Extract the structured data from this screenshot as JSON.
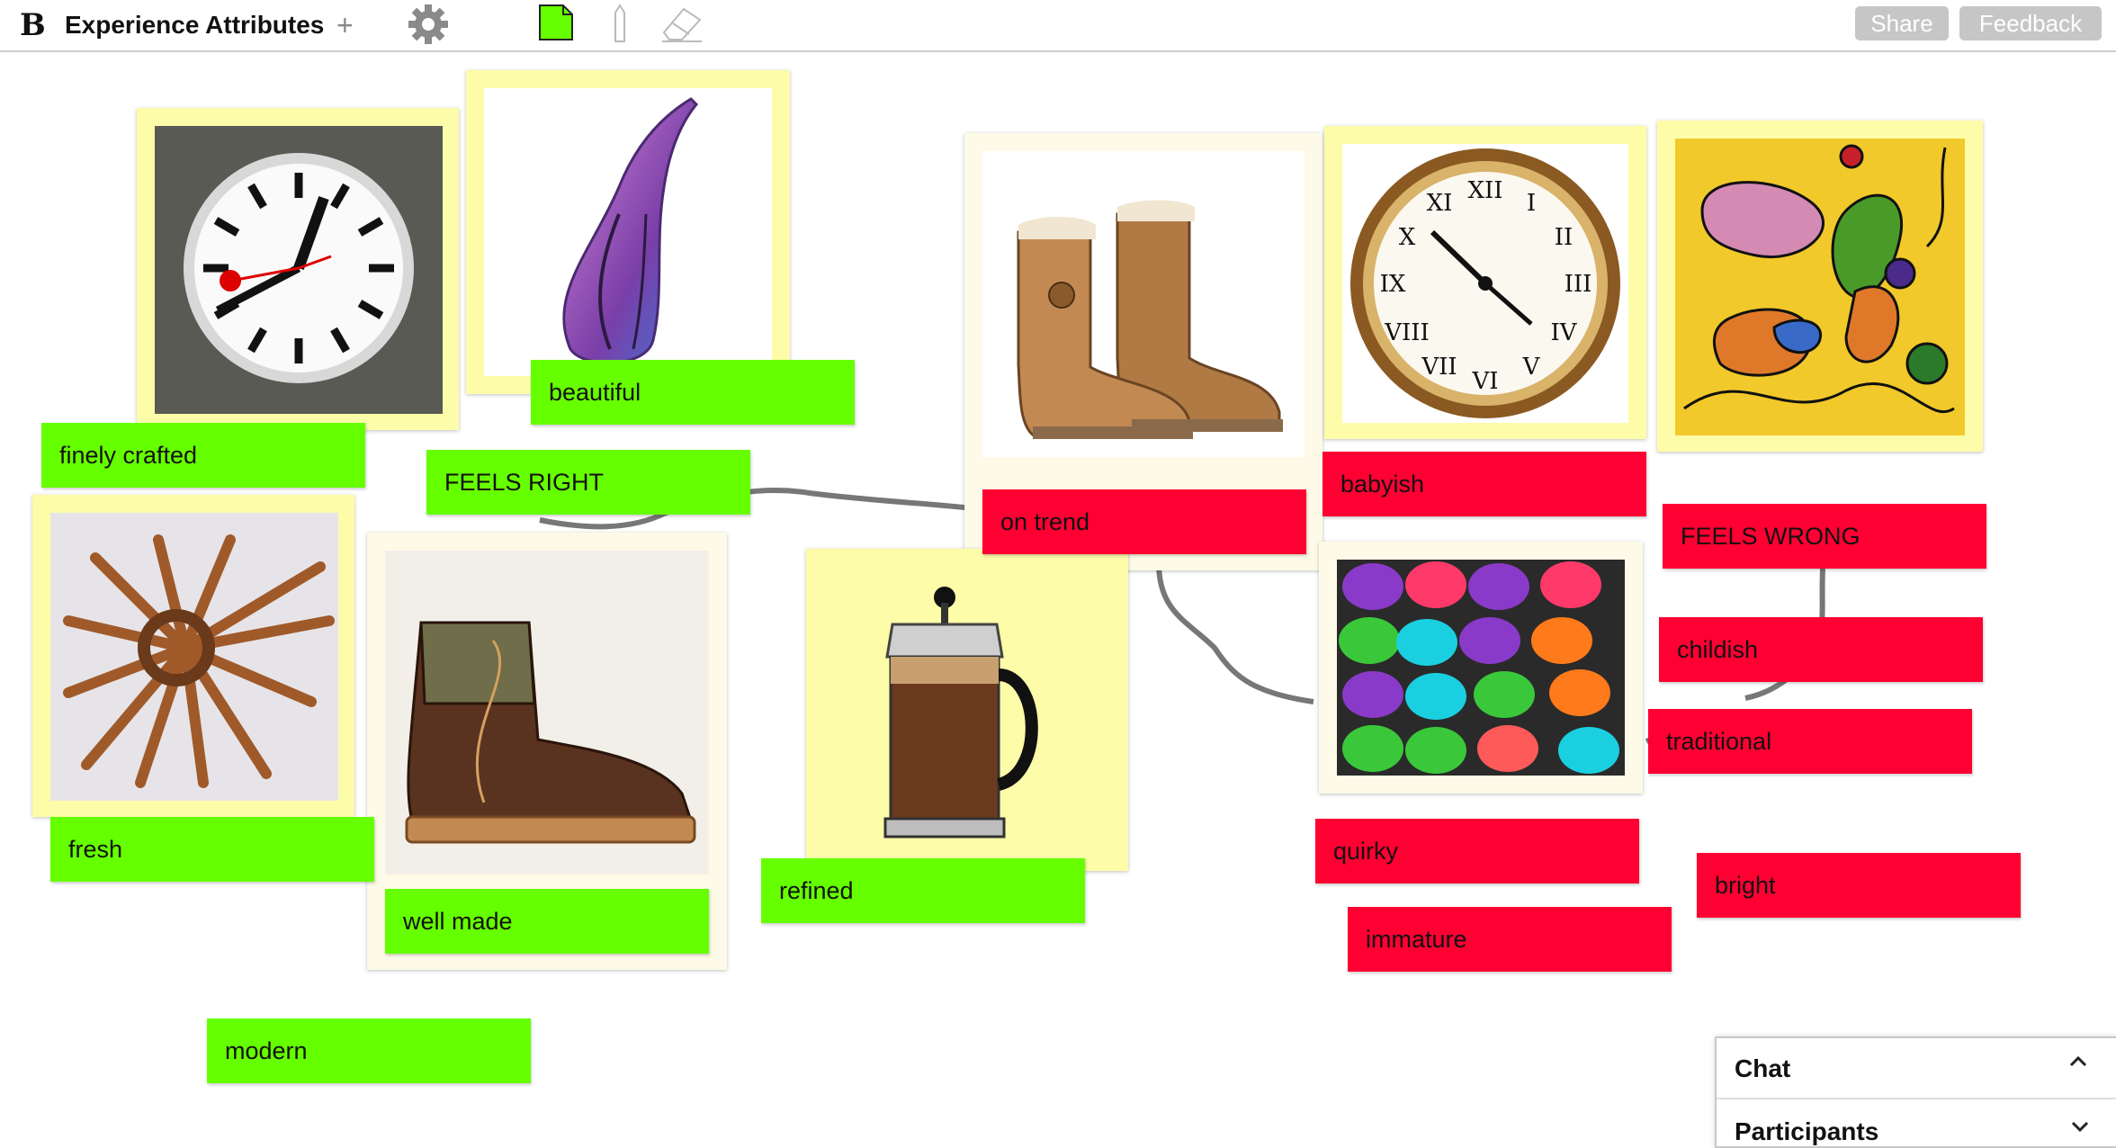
{
  "app": {
    "logo": "B",
    "board_title": "Experience Attributes",
    "add_label": "+",
    "share_label": "Share",
    "feedback_label": "Feedback"
  },
  "tools": {
    "settings_icon": "gear-icon",
    "note_tool_icon": "sticky-note-icon",
    "pen_tool_icon": "pencil-icon",
    "eraser_tool_icon": "eraser-icon"
  },
  "colors": {
    "positive_sticky": "#66ff00",
    "negative_sticky": "#ff0033",
    "image_card": "#fdfca9"
  },
  "images": [
    {
      "id": "clock-station",
      "subject": "station wall clock"
    },
    {
      "id": "vase",
      "subject": "purple glass vase"
    },
    {
      "id": "boots-ugg",
      "subject": "sheepskin boots"
    },
    {
      "id": "clock-antique",
      "subject": "antique roman numeral clock"
    },
    {
      "id": "abstract-art",
      "subject": "abstract colorful drawing"
    },
    {
      "id": "sculpture",
      "subject": "wooden spiral sculpture"
    },
    {
      "id": "boot-leather",
      "subject": "leather work boot"
    },
    {
      "id": "french-press",
      "subject": "french press coffee maker"
    },
    {
      "id": "crocs",
      "subject": "colorful clogs"
    }
  ],
  "stickies": {
    "finely_crafted": "finely crafted",
    "beautiful": "beautiful",
    "feels_right": "FEELS RIGHT",
    "on_trend": "on trend",
    "babyish": "babyish",
    "feels_wrong": "FEELS WRONG",
    "fresh": "fresh",
    "well_made": "well made",
    "refined": "refined",
    "childish": "childish",
    "traditional": "traditional",
    "quirky": "quirky",
    "bright": "bright",
    "immature": "immature",
    "modern": "modern"
  },
  "chat": {
    "title": "Chat",
    "participants": "Participants"
  }
}
